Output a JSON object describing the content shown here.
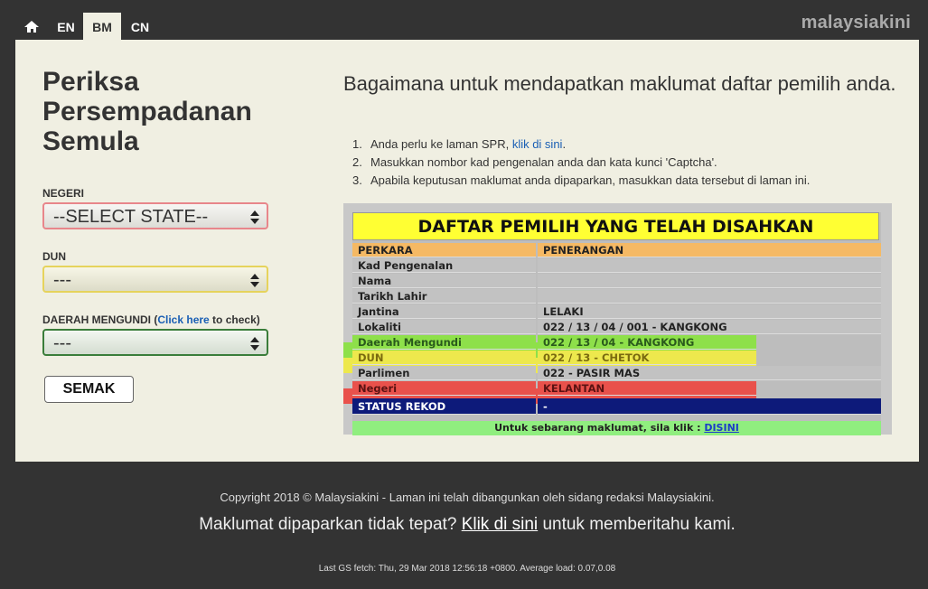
{
  "nav": {
    "home_icon": "home-icon",
    "tabs": [
      "EN",
      "BM",
      "CN"
    ],
    "active_tab": "BM",
    "brand": "malaysiakini"
  },
  "left": {
    "title": "Periksa Persempadanan Semula",
    "negeri_label": "NEGERI",
    "negeri_value": "--SELECT STATE--",
    "dun_label": "DUN",
    "dun_value": "---",
    "daerah_label": "DAERAH MENGUNDI",
    "daerah_paren_open": " (",
    "daerah_link": "Click here",
    "daerah_link_rest": " to check)",
    "daerah_value": "---",
    "button": "SEMAK"
  },
  "right": {
    "title": "Bagaimana untuk mendapatkan maklumat daftar pemilih anda.",
    "steps": [
      {
        "num": "1.",
        "text": "Anda perlu ke laman SPR, ",
        "link": "klik di sini",
        "after": "."
      },
      {
        "num": "2.",
        "text": "Masukkan nombor kad pengenalan anda dan kata kunci 'Captcha'.",
        "link": "",
        "after": ""
      },
      {
        "num": "3.",
        "text": "Apabila keputusan maklumat anda dipaparkan, masukkan data tersebut di laman ini.",
        "link": "",
        "after": ""
      }
    ]
  },
  "sample": {
    "title": "DAFTAR PEMILIH YANG TELAH DISAHKAN",
    "head": [
      "PERKARA",
      "PENERANGAN"
    ],
    "rows": [
      [
        "Kad Pengenalan",
        ""
      ],
      [
        "Nama",
        ""
      ],
      [
        "Tarikh Lahir",
        ""
      ],
      [
        "Jantina",
        "LELAKI"
      ],
      [
        "Lokaliti",
        "022 / 13 / 04 / 001 - KANGKONG"
      ],
      [
        "Daerah Mengundi",
        "022 / 13 / 04 - KANGKONG"
      ],
      [
        "DUN",
        "022 / 13 - CHETOK"
      ],
      [
        "Parlimen",
        "022 - PASIR MAS"
      ],
      [
        "Negeri",
        "KELANTAN"
      ]
    ],
    "status": [
      "STATUS REKOD",
      "-"
    ],
    "footer_text": "Untuk sebarang maklumat, sila klik : ",
    "footer_link": "DISINI",
    "highlight_colors": {
      "daerah": "#8ee04a",
      "dun": "#ede84d",
      "negeri": "#e9514b"
    }
  },
  "footer": {
    "copyright": "Copyright 2018 © Malaysiakini - Laman ini telah dibangunkan oleh sidang redaksi Malaysiakini.",
    "report_before": "Maklumat dipaparkan tidak tepat? ",
    "report_link": "Klik di sini",
    "report_after": " untuk memberitahu kami.",
    "last_fetch": "Last GS fetch: Thu, 29 Mar 2018 12:56:18 +0800. Average load: 0.07,0.08"
  }
}
